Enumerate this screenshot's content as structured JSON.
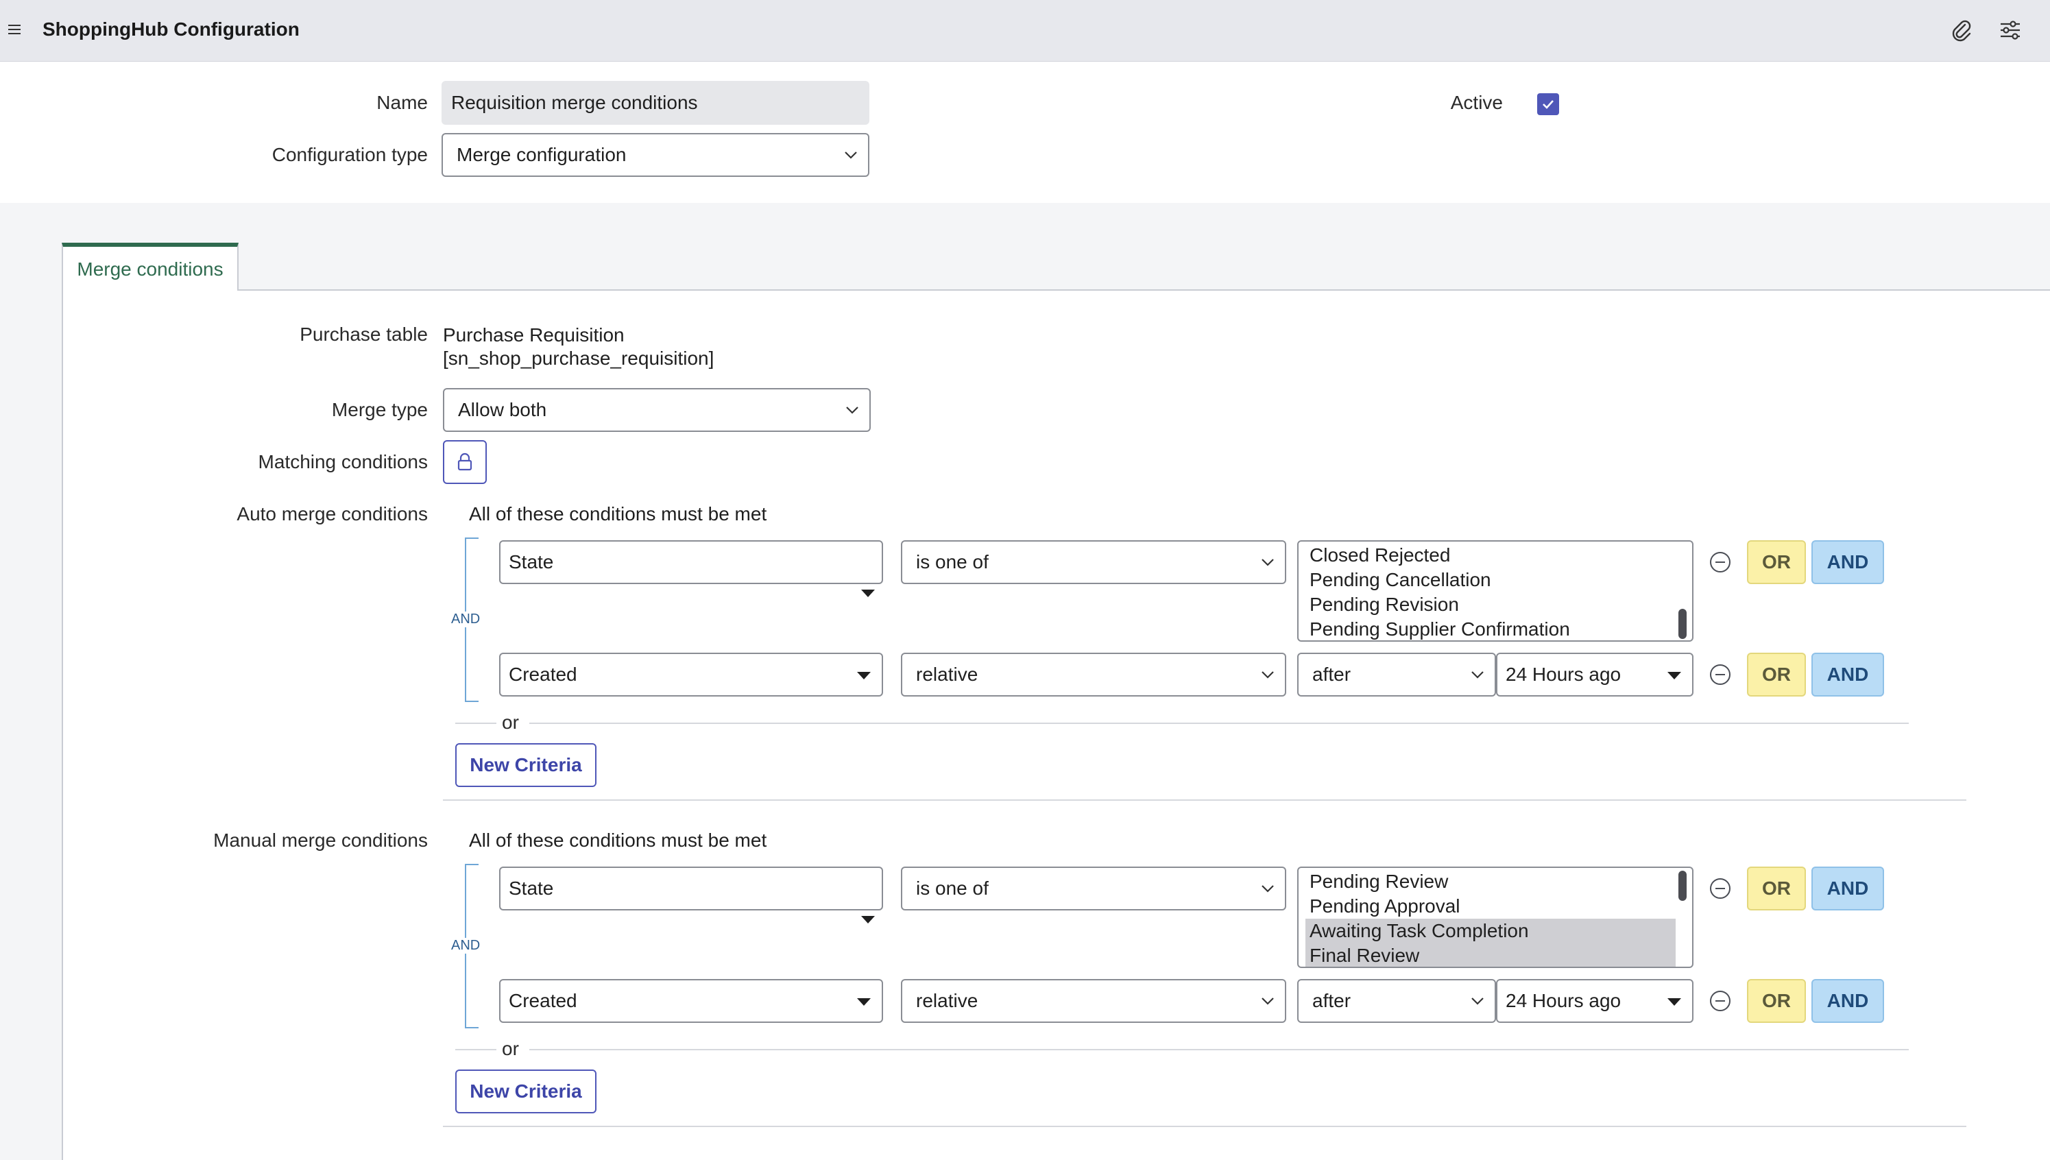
{
  "header": {
    "title": "ShoppingHub Configuration",
    "icons": [
      "menu-icon",
      "paperclip-icon",
      "sliders-icon"
    ]
  },
  "form": {
    "name_label": "Name",
    "name_value": "Requisition merge conditions",
    "config_type_label": "Configuration type",
    "config_type_value": "Merge configuration",
    "active_label": "Active",
    "active_checked": true
  },
  "tabs": [
    {
      "label": "Merge conditions",
      "active": true
    }
  ],
  "merge": {
    "purchase_table_label": "Purchase table",
    "purchase_table_line1": "Purchase Requisition",
    "purchase_table_line2": "[sn_shop_purchase_requisition]",
    "merge_type_label": "Merge type",
    "merge_type_value": "Allow both",
    "matching_label": "Matching conditions"
  },
  "auto": {
    "label": "Auto merge conditions",
    "heading": "All of these conditions must be met",
    "and_label": "AND",
    "or_label": "or",
    "new_criteria": "New Criteria",
    "row1": {
      "field": "State",
      "operator": "is one of",
      "options": [
        "Closed Rejected",
        "Pending Cancellation",
        "Pending Revision",
        "Pending Supplier Confirmation"
      ]
    },
    "row2": {
      "field": "Created",
      "operator": "relative",
      "direction": "after",
      "amount": "24 Hours ago"
    }
  },
  "manual": {
    "label": "Manual merge conditions",
    "heading": "All of these conditions must be met",
    "and_label": "AND",
    "or_label": "or",
    "new_criteria": "New Criteria",
    "row1": {
      "field": "State",
      "operator": "is one of",
      "options": [
        "Pending Review",
        "Pending Approval",
        "Awaiting Task Completion",
        "Final Review"
      ],
      "selected": [
        "Awaiting Task Completion",
        "Final Review"
      ]
    },
    "row2": {
      "field": "Created",
      "operator": "relative",
      "direction": "after",
      "amount": "24 Hours ago"
    }
  },
  "buttons": {
    "or": "OR",
    "and": "AND"
  },
  "colors": {
    "accent": "#4f57b8",
    "tab_green": "#2f6b4f",
    "or_yellow": "#fbf1a8",
    "and_blue": "#b9dcf6"
  }
}
